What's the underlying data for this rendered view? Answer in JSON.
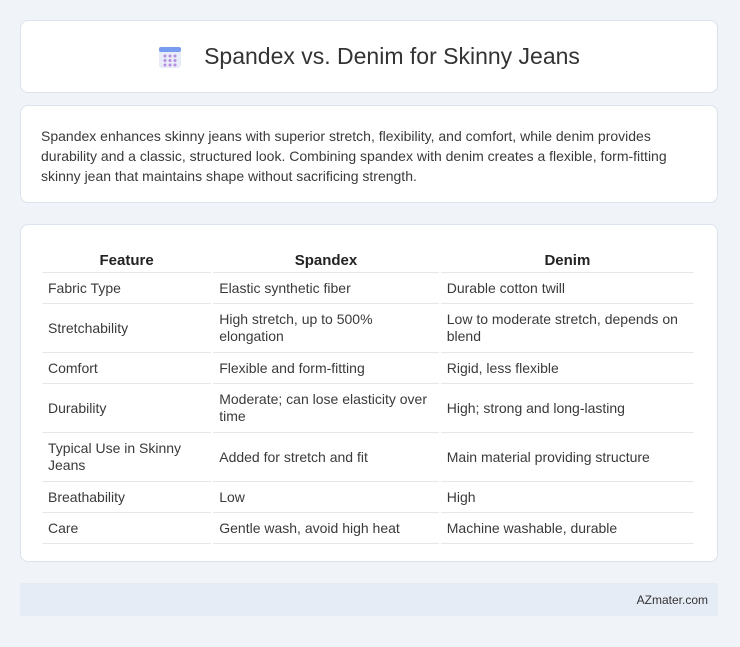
{
  "header": {
    "title": "Spandex vs. Denim for Skinny Jeans",
    "icon": "calendar-grid-icon"
  },
  "summary": {
    "text": "Spandex enhances skinny jeans with superior stretch, flexibility, and comfort, while denim provides durability and a classic, structured look. Combining spandex with denim creates a flexible, form-fitting skinny jean that maintains shape without sacrificing strength."
  },
  "table": {
    "headers": [
      "Feature",
      "Spandex",
      "Denim"
    ],
    "rows": [
      [
        "Fabric Type",
        "Elastic synthetic fiber",
        "Durable cotton twill"
      ],
      [
        "Stretchability",
        "High stretch, up to 500% elongation",
        "Low to moderate stretch, depends on blend"
      ],
      [
        "Comfort",
        "Flexible and form-fitting",
        "Rigid, less flexible"
      ],
      [
        "Durability",
        "Moderate; can lose elasticity over time",
        "High; strong and long-lasting"
      ],
      [
        "Typical Use in Skinny Jeans",
        "Added for stretch and fit",
        "Main material providing structure"
      ],
      [
        "Breathability",
        "Low",
        "High"
      ],
      [
        "Care",
        "Gentle wash, avoid high heat",
        "Machine washable, durable"
      ]
    ]
  },
  "footer": {
    "text": "AZmater.com"
  },
  "colors": {
    "background": "#f0f3f8",
    "card": "#ffffff",
    "footer_bg": "#e6ecf5",
    "icon_blue": "#6b8fe8",
    "icon_purple": "#b68de0"
  }
}
